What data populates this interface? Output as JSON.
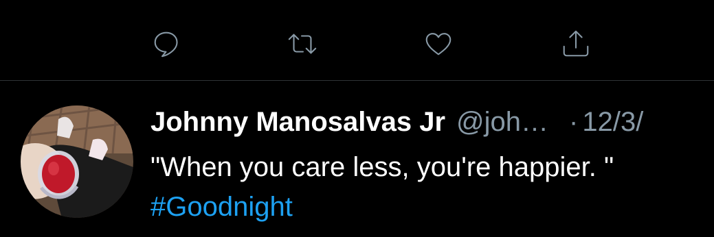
{
  "actions": {
    "reply_icon": "speech-bubble",
    "retweet_icon": "retweet-arrows",
    "like_icon": "heart",
    "share_icon": "share-upload"
  },
  "tweet": {
    "display_name": "Johnny Manosalvas Jr",
    "handle": "@joh…",
    "separator": "·",
    "time": "12/3/",
    "text": "\"When you care less, you're happier. \"",
    "hashtag": "#Goodnight"
  },
  "colors": {
    "background": "#000000",
    "icon": "#8899a6",
    "secondary_text": "#8899a6",
    "link": "#1da1f2",
    "divider": "#2f3336"
  }
}
